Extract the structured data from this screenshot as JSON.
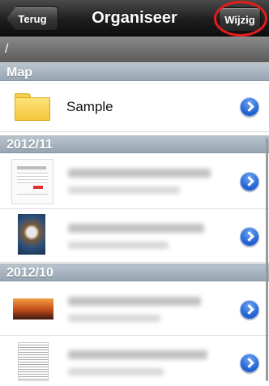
{
  "navbar": {
    "back_label": "Terug",
    "title": "Organiseer",
    "edit_label": "Wijzig"
  },
  "path": "/",
  "sections": {
    "map": {
      "header": "Map",
      "items": [
        {
          "label": "Sample",
          "icon": "folder-icon"
        }
      ]
    },
    "nov": {
      "header": "2012/11"
    },
    "oct": {
      "header": "2012/10"
    }
  },
  "colors": {
    "navbar": "#1e1e1e",
    "section_header": "#a4b1bd",
    "disclosure": "#1f5fd0",
    "highlight": "#e41c1c"
  }
}
